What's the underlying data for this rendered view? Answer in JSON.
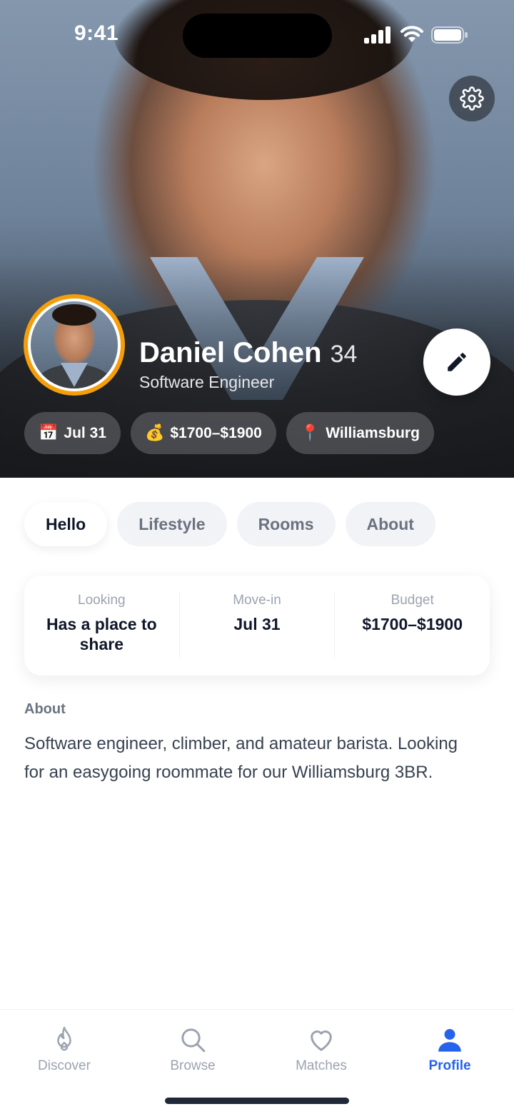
{
  "status_bar": {
    "time": "9:41"
  },
  "profile": {
    "name": "Daniel Cohen",
    "age": "34",
    "job": "Software Engineer",
    "chips": [
      {
        "icon": "📅",
        "icon_name": "calendar-icon",
        "label": "Jul 31"
      },
      {
        "icon": "💰",
        "icon_name": "money-bag-icon",
        "label": "$1700–$1900"
      },
      {
        "icon": "📍",
        "icon_name": "pin-icon",
        "label": "Williamsburg"
      }
    ]
  },
  "tabs": [
    {
      "label": "Hello",
      "active": true
    },
    {
      "label": "Lifestyle",
      "active": false
    },
    {
      "label": "Rooms",
      "active": false
    },
    {
      "label": "About",
      "active": false
    }
  ],
  "stats": [
    {
      "label": "Looking",
      "value": "Has a place to share"
    },
    {
      "label": "Move-in",
      "value": "Jul 31"
    },
    {
      "label": "Budget",
      "value": "$1700–$1900"
    }
  ],
  "about": {
    "title": "About",
    "text": "Software engineer, climber, and amateur barista. Looking for an easygoing roommate for our Williamsburg 3BR."
  },
  "bottom_nav": [
    {
      "label": "Discover",
      "icon": "flame-icon",
      "active": false
    },
    {
      "label": "Browse",
      "icon": "search-icon",
      "active": false
    },
    {
      "label": "Matches",
      "icon": "heart-icon",
      "active": false
    },
    {
      "label": "Profile",
      "icon": "person-icon",
      "active": true
    }
  ],
  "colors": {
    "accent": "#2563eb",
    "avatar_ring": "#f59e0b"
  }
}
